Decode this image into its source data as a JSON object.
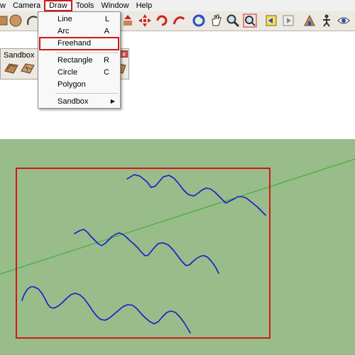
{
  "menubar": {
    "items": [
      {
        "label": "w",
        "active": false
      },
      {
        "label": "Camera",
        "active": false
      },
      {
        "label": "Draw",
        "active": true
      },
      {
        "label": "Tools",
        "active": false
      },
      {
        "label": "Window",
        "active": false
      },
      {
        "label": "Help",
        "active": false
      }
    ]
  },
  "draw_menu": {
    "items": [
      {
        "label": "Line",
        "shortcut": "L"
      },
      {
        "label": "Arc",
        "shortcut": "A"
      },
      {
        "label": "Freehand",
        "shortcut": "",
        "highlighted": true
      },
      {
        "label": "Rectangle",
        "shortcut": "R"
      },
      {
        "label": "Circle",
        "shortcut": "C"
      },
      {
        "label": "Polygon",
        "shortcut": ""
      },
      {
        "label": "Sandbox",
        "submenu": true
      }
    ]
  },
  "sandbox_toolbar": {
    "title": "Sandbox",
    "close_glyph": "x"
  },
  "toolbar_icons": [
    "box-icon",
    "circle-icon",
    "arc-icon",
    "push-pull-icon",
    "move-icon",
    "rotate-icon",
    "follow-me-icon",
    "orbit-icon",
    "pan-icon",
    "zoom-icon",
    "zoom-extents-icon",
    "previous-view-icon",
    "next-view-icon",
    "position-camera-icon",
    "walk-icon",
    "look-around-icon"
  ],
  "colors": {
    "ground": "#98bc8a",
    "sky": "#ffffff",
    "freehand_stroke": "#1a1acc",
    "axis_green": "#2cb02c",
    "highlight_red": "#d01818"
  }
}
